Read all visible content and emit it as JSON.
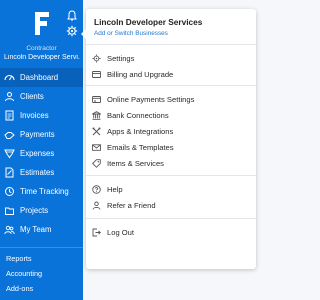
{
  "sidebar": {
    "logo_letter": "F",
    "account_role": "Contractor",
    "account_name": "Lincoln Developer Servi...",
    "nav_items": [
      {
        "label": "Dashboard",
        "icon": "dashboard-icon"
      },
      {
        "label": "Clients",
        "icon": "clients-icon"
      },
      {
        "label": "Invoices",
        "icon": "invoices-icon"
      },
      {
        "label": "Payments",
        "icon": "payments-icon"
      },
      {
        "label": "Expenses",
        "icon": "expenses-icon"
      },
      {
        "label": "Estimates",
        "icon": "estimates-icon"
      },
      {
        "label": "Time Tracking",
        "icon": "time-tracking-icon"
      },
      {
        "label": "Projects",
        "icon": "projects-icon"
      },
      {
        "label": "My Team",
        "icon": "my-team-icon"
      }
    ],
    "footer_links": [
      "Reports",
      "Accounting",
      "Add-ons"
    ],
    "active_item": "Dashboard"
  },
  "dropdown": {
    "business_name": "Lincoln Developer Services",
    "switch_link": "Add or Switch Businesses",
    "items": [
      {
        "label": "Settings",
        "icon": "gear-icon"
      },
      {
        "label": "Billing and Upgrade",
        "icon": "billing-icon"
      },
      {
        "label": "Online Payments Settings",
        "icon": "online-payments-icon"
      },
      {
        "label": "Bank Connections",
        "icon": "bank-icon"
      },
      {
        "label": "Apps & Integrations",
        "icon": "apps-icon"
      },
      {
        "label": "Emails & Templates",
        "icon": "email-icon"
      },
      {
        "label": "Items & Services",
        "icon": "tag-icon"
      },
      {
        "label": "Help",
        "icon": "help-icon"
      },
      {
        "label": "Refer a Friend",
        "icon": "refer-icon"
      },
      {
        "label": "Log Out",
        "icon": "logout-icon"
      }
    ]
  },
  "colors": {
    "sidebar_bg": "#0a73d9",
    "active_bg": "#0862bb",
    "link": "#1f78d1"
  }
}
